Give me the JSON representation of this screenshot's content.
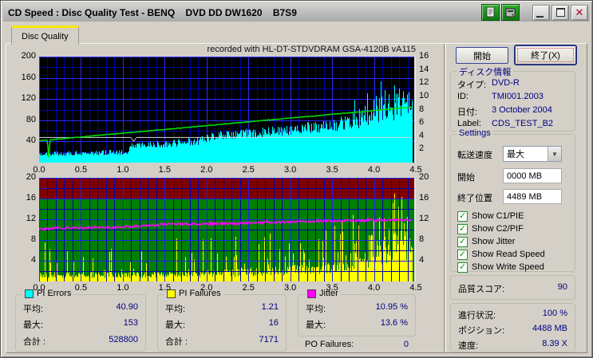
{
  "window": {
    "title": "CD Speed : Disc Quality Test - BENQ    DVD DD DW1620    B7S9"
  },
  "tab": {
    "label": "Disc Quality"
  },
  "chart_header": {
    "recorded_with": "recorded with HL-DT-STDVDRAM GSA-4120B vA115"
  },
  "icons": {
    "check": "✓",
    "combo_arrow": "▼",
    "close": "✕"
  },
  "legend": {
    "pi_errors": {
      "title": "PI Errors",
      "swatch": "#00ffff",
      "rows": [
        {
          "label": "平均:",
          "value": "40.90"
        },
        {
          "label": "最大:",
          "value": "153"
        },
        {
          "label": "合計 :",
          "value": "528800"
        }
      ]
    },
    "pi_failures": {
      "title": "PI Failures",
      "swatch": "#ffff00",
      "rows": [
        {
          "label": "平均:",
          "value": "1.21"
        },
        {
          "label": "最大:",
          "value": "16"
        },
        {
          "label": "合計 :",
          "value": "7171"
        }
      ]
    },
    "jitter": {
      "title": "Jitter",
      "swatch": "#ff00ff",
      "rows": [
        {
          "label": "平均:",
          "value": "10.95 %"
        },
        {
          "label": "最大:",
          "value": "13.6 %"
        }
      ]
    },
    "po_failures": {
      "label": "PO Failures:",
      "value": "0"
    }
  },
  "panel": {
    "start_button": "開始",
    "exit_button": "終了(X)",
    "disc_info": {
      "title": "ディスク情報",
      "rows": [
        {
          "label": "タイプ:",
          "value": "DVD-R"
        },
        {
          "label": "ID:",
          "value": "TMI001.2003"
        },
        {
          "label": "日付:",
          "value": "3 October 2004"
        },
        {
          "label": "Label:",
          "value": "CDS_TEST_B2"
        }
      ]
    },
    "settings": {
      "title": "Settings",
      "speed_label": "転送速度",
      "speed_value": "最大",
      "start_label": "開始",
      "start_value": "0000 MB",
      "end_label": "終了位置",
      "end_value": "4489 MB",
      "checkboxes": [
        {
          "label": "Show C1/PIE",
          "checked": true
        },
        {
          "label": "Show C2/PIF",
          "checked": true
        },
        {
          "label": "Show Jitter",
          "checked": true
        },
        {
          "label": "Show Read Speed",
          "checked": true
        },
        {
          "label": "Show Write Speed",
          "checked": true
        }
      ]
    },
    "score": {
      "label": "品質スコア:",
      "value": "90"
    },
    "progress": {
      "rows": [
        {
          "label": "進行状況:",
          "value": "100 %"
        },
        {
          "label": "ポジション:",
          "value": "4488 MB"
        },
        {
          "label": "速度:",
          "value": "8.39 X"
        }
      ]
    }
  },
  "chart_data": [
    {
      "id": "main",
      "type": "area",
      "title": "PI Errors / Read & Write Speed",
      "x_range": [
        0,
        4.5
      ],
      "x_ticks": [
        "0.0",
        "0.5",
        "1.0",
        "1.5",
        "2.0",
        "2.5",
        "3.0",
        "3.5",
        "4.0",
        "4.5"
      ],
      "left_range": [
        0,
        200
      ],
      "left_ticks": [
        200,
        160,
        120,
        80,
        40
      ],
      "right_range": [
        0,
        16
      ],
      "right_ticks": [
        16,
        14,
        12,
        10,
        8,
        6,
        4,
        2
      ],
      "bg": "#000000",
      "zones": [],
      "grid": {
        "x_minor": 0.1,
        "x_major": 0.5,
        "y_minor": 20,
        "y_major": 40,
        "minor_color": "#0000a8",
        "major_color": "#2a2aff"
      },
      "grid_over_first_series": false,
      "data_end_x": 4.46,
      "marker_x": 4.487,
      "marker_color": "#e4e4e4",
      "series": [
        {
          "name": "PI Errors",
          "type": "fill",
          "color": "#00ffff",
          "scale": "left",
          "base": [
            [
              0,
              15
            ],
            [
              1.05,
              18
            ],
            [
              1.1,
              30
            ],
            [
              1.5,
              33
            ],
            [
              1.9,
              38
            ],
            [
              2.1,
              48
            ],
            [
              2.5,
              52
            ],
            [
              3.0,
              58
            ],
            [
              3.5,
              65
            ],
            [
              3.8,
              75
            ],
            [
              4.0,
              88
            ],
            [
              4.2,
              95
            ],
            [
              4.46,
              100
            ]
          ],
          "amp": [
            [
              0,
              8
            ],
            [
              1.0,
              10
            ],
            [
              1.5,
              14
            ],
            [
              2.0,
              16
            ],
            [
              3.0,
              20
            ],
            [
              3.5,
              25
            ],
            [
              3.9,
              40
            ],
            [
              4.2,
              55
            ],
            [
              4.46,
              55
            ]
          ],
          "spikes": [
            [
              3.77,
              118
            ],
            [
              3.92,
              131
            ],
            [
              4.02,
              126
            ],
            [
              4.08,
              153
            ],
            [
              4.13,
              137
            ],
            [
              4.18,
              129
            ],
            [
              4.24,
              146
            ],
            [
              4.3,
              140
            ],
            [
              4.36,
              122
            ],
            [
              4.41,
              133
            ]
          ],
          "stat_avg": 40.9,
          "stat_max": 153,
          "stat_total": 528800
        },
        {
          "name": "Read Speed",
          "type": "line",
          "color": "#d8d8d8",
          "scale": "right",
          "width": 1,
          "points": [
            [
              0,
              3.8
            ],
            [
              1.1,
              3.8
            ],
            [
              1.13,
              3.15
            ],
            [
              1.16,
              3.8
            ],
            [
              4.46,
              3.8
            ]
          ],
          "noise": 0
        },
        {
          "name": "Write Speed",
          "type": "line",
          "color": "#00dd00",
          "scale": "right",
          "width": 1.5,
          "points": [
            [
              0,
              3.3
            ],
            [
              0.1,
              3.4
            ],
            [
              0.115,
              0.7
            ],
            [
              0.13,
              3.45
            ],
            [
              4.46,
              8.39
            ]
          ],
          "noise": 0.05
        }
      ]
    },
    {
      "id": "pif",
      "type": "bar",
      "title": "PI Failures / Jitter",
      "x_range": [
        0,
        4.5
      ],
      "x_ticks": [
        "0.0",
        "0.5",
        "1.0",
        "1.5",
        "2.0",
        "2.5",
        "3.0",
        "3.5",
        "4.0",
        "4.5"
      ],
      "left_range": [
        0,
        20
      ],
      "left_ticks": [
        20,
        16,
        12,
        8,
        4
      ],
      "right_range": [
        0,
        20
      ],
      "right_ticks": [
        20,
        16,
        12,
        8,
        4
      ],
      "bg": "#008000",
      "zones": [
        {
          "from": 16,
          "to": 20,
          "color": "#7e0000"
        }
      ],
      "grid": {
        "x_minor": 0.1,
        "x_major": 0.5,
        "y_minor": 2,
        "y_major": 4,
        "minor_color": "#0000b0",
        "major_color": "#2020f0"
      },
      "grid_over_first_series": true,
      "data_end_x": 4.46,
      "marker_x": 4.487,
      "marker_color": "#e4e4e4",
      "series": [
        {
          "name": "PI Failures",
          "type": "bars",
          "color": "#ffff00",
          "scale": "left",
          "base": [
            [
              0,
              1.2
            ],
            [
              1.5,
              1.3
            ],
            [
              2.0,
              1.5
            ],
            [
              2.8,
              1.9
            ],
            [
              3.3,
              2.4
            ],
            [
              3.8,
              3.5
            ],
            [
              4.1,
              5
            ],
            [
              4.3,
              6.5
            ],
            [
              4.46,
              7
            ]
          ],
          "density": [
            [
              0,
              0.12
            ],
            [
              1.5,
              0.14
            ],
            [
              2.0,
              0.2
            ],
            [
              3.0,
              0.3
            ],
            [
              3.5,
              0.4
            ],
            [
              4.0,
              0.55
            ],
            [
              4.46,
              0.65
            ]
          ],
          "spike_max": [
            [
              0,
              5.5
            ],
            [
              1.0,
              6
            ],
            [
              2.0,
              8
            ],
            [
              3.0,
              8
            ],
            [
              3.6,
              10
            ],
            [
              4.0,
              12
            ],
            [
              4.3,
              14
            ],
            [
              4.46,
              13
            ]
          ],
          "spikes": [
            [
              0.07,
              7.5
            ],
            [
              0.12,
              6.2
            ],
            [
              0.33,
              6.0
            ],
            [
              0.86,
              6.3
            ],
            [
              1.22,
              5.8
            ],
            [
              1.64,
              8.3
            ],
            [
              1.95,
              8.1
            ],
            [
              2.35,
              8.6
            ],
            [
              2.62,
              7.2
            ],
            [
              2.76,
              9.2
            ],
            [
              3.12,
              7.4
            ],
            [
              3.38,
              8.0
            ],
            [
              3.62,
              9.6
            ],
            [
              3.9,
              10.4
            ],
            [
              4.12,
              12.2
            ],
            [
              4.33,
              16.3
            ]
          ],
          "stat_avg": 1.21,
          "stat_max": 16,
          "stat_total": 7171
        },
        {
          "name": "Jitter",
          "type": "line",
          "color": "#ff00ff",
          "scale": "left",
          "width": 1.5,
          "points": [
            [
              0,
              10.1
            ],
            [
              0.3,
              10.3
            ],
            [
              0.6,
              10.4
            ],
            [
              0.9,
              10.4
            ],
            [
              1.2,
              10.7
            ],
            [
              1.5,
              11.0
            ],
            [
              1.9,
              11.1
            ],
            [
              2.3,
              11.2
            ],
            [
              2.7,
              11.3
            ],
            [
              3.0,
              11.5
            ],
            [
              3.4,
              11.6
            ],
            [
              3.8,
              11.7
            ],
            [
              4.1,
              11.8
            ],
            [
              4.46,
              11.9
            ]
          ],
          "noise": 0.22,
          "spike_prob": 0.02,
          "spike_amp": 1.1,
          "stat_avg_pct": 10.95,
          "stat_max_pct": 13.6
        }
      ]
    }
  ]
}
